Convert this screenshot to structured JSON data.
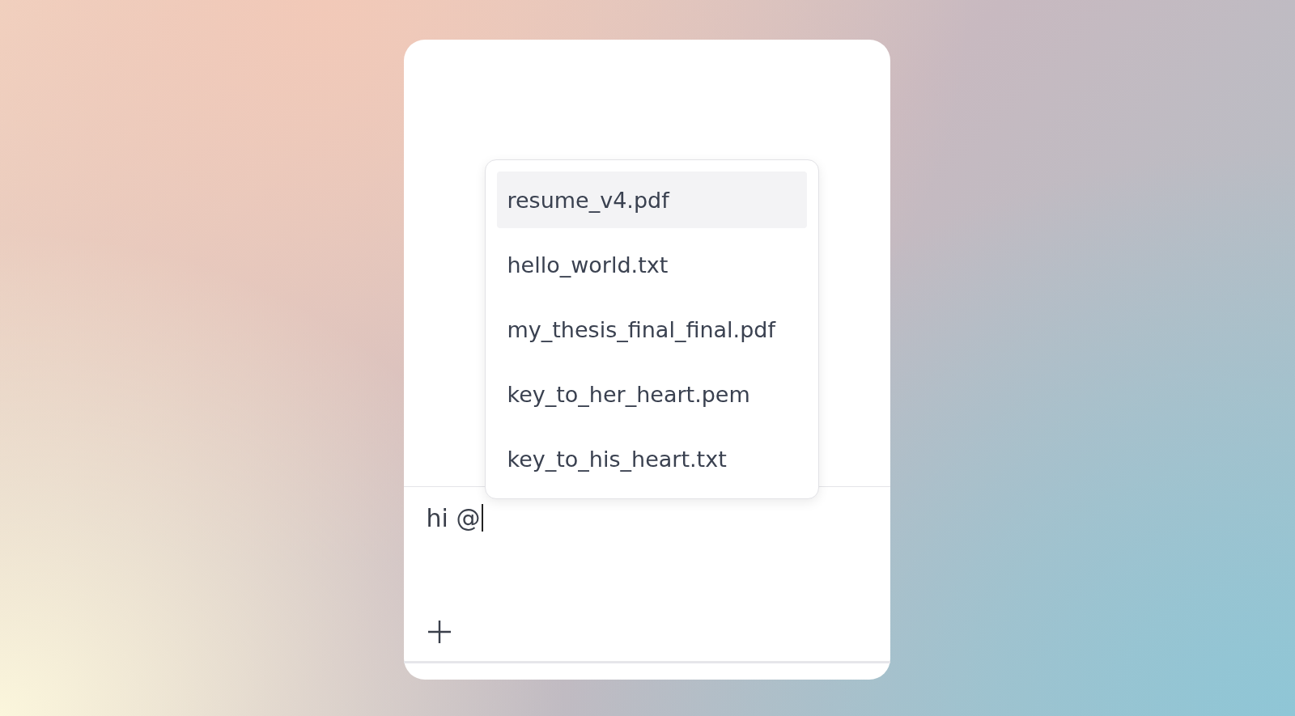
{
  "mention_menu": {
    "items": [
      {
        "label": "resume_v4.pdf",
        "selected": true
      },
      {
        "label": "hello_world.txt",
        "selected": false
      },
      {
        "label": "my_thesis_final_final.pdf",
        "selected": false
      },
      {
        "label": "key_to_her_heart.pem",
        "selected": false
      },
      {
        "label": "key_to_his_heart.txt",
        "selected": false
      }
    ]
  },
  "composer": {
    "value": "hi @"
  }
}
